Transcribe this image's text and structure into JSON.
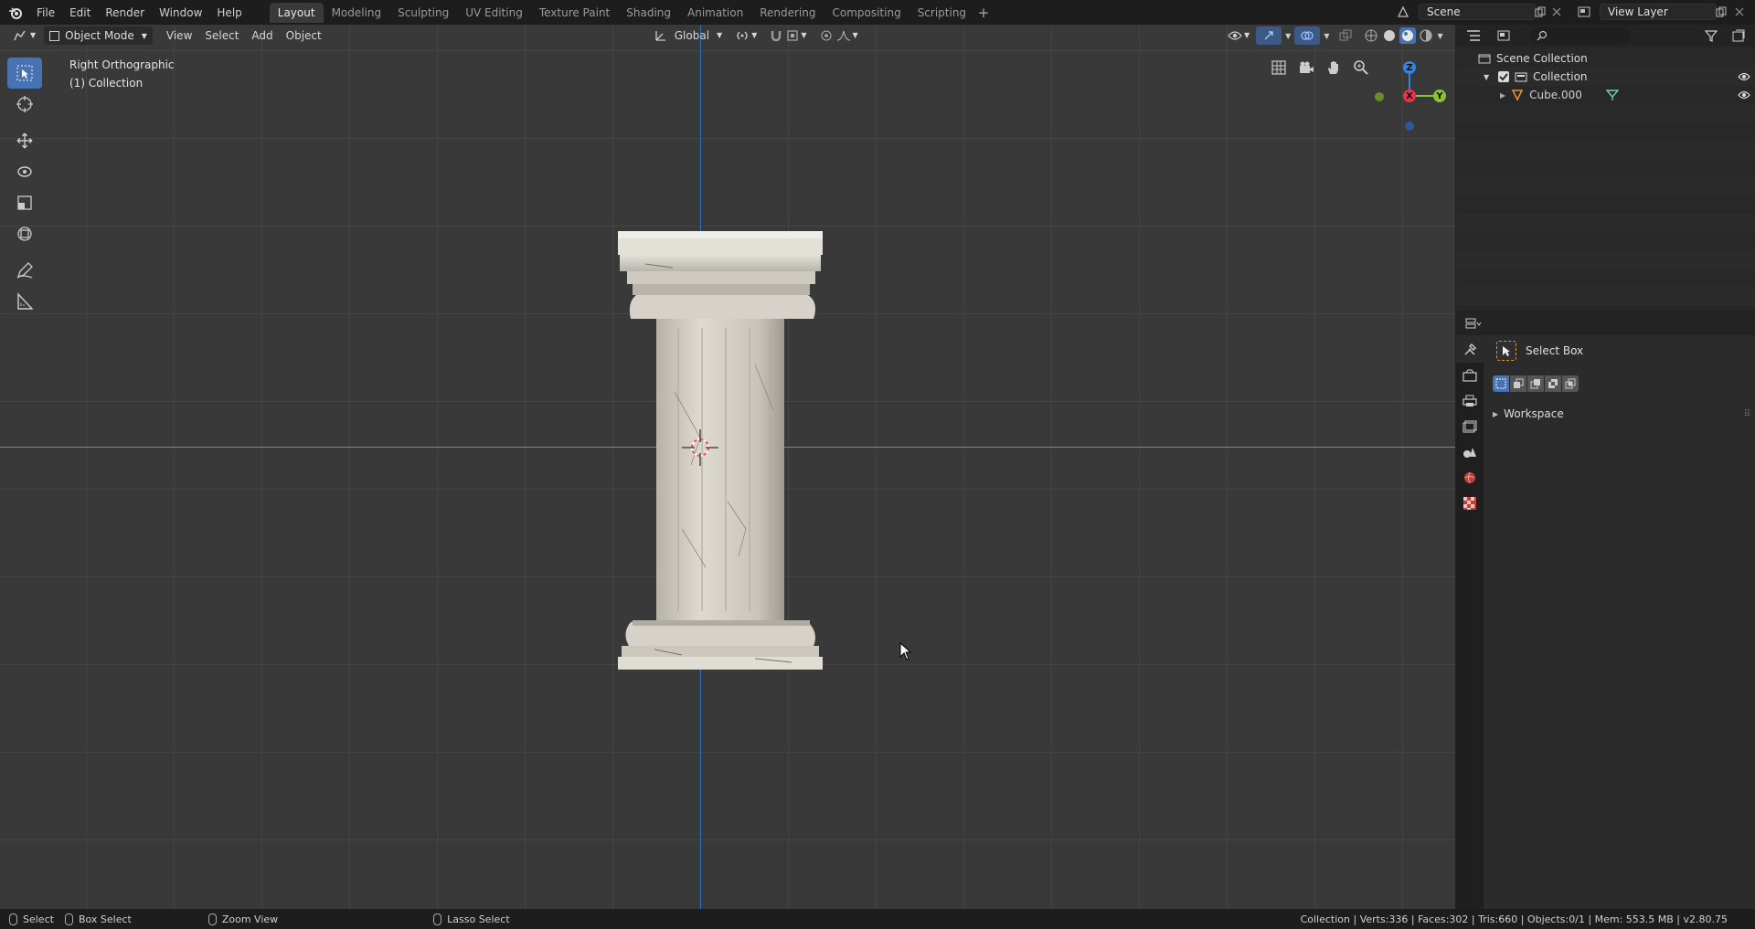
{
  "topbar": {
    "logo_icon": "blender-logo-icon",
    "menus": [
      "File",
      "Edit",
      "Render",
      "Window",
      "Help"
    ],
    "workspaces": [
      "Layout",
      "Modeling",
      "Sculpting",
      "UV Editing",
      "Texture Paint",
      "Shading",
      "Animation",
      "Rendering",
      "Compositing",
      "Scripting"
    ],
    "active_workspace": "Layout",
    "add_workspace": "+",
    "scene": "Scene",
    "view_layer": "View Layer"
  },
  "viewport": {
    "mode": "Object Mode",
    "menus": [
      "View",
      "Select",
      "Add",
      "Object"
    ],
    "orientation": "Global",
    "view_name": "Right Orthographic",
    "collection_info": "(1) Collection",
    "gizmo": {
      "z": "Z",
      "x": "X",
      "y": "Y"
    },
    "axis_colors": {
      "x": "#e2364e",
      "y": "#8bc232",
      "z": "#2f84e3"
    }
  },
  "outliner": {
    "rows": [
      {
        "label": "Scene Collection"
      },
      {
        "label": "Collection"
      },
      {
        "label": "Cube.000"
      }
    ]
  },
  "properties": {
    "tool_name": "Select Box",
    "panel": "Workspace"
  },
  "statusbar": {
    "left": [
      "Select",
      "Box Select",
      "Zoom View",
      "Lasso Select"
    ],
    "stats": "Collection | Verts:336 | Faces:302 | Tris:660 | Objects:0/1 | Mem: 553.5 MB | v2.80.75"
  },
  "colors": {
    "accent": "#4772b3",
    "background": "#393939"
  }
}
